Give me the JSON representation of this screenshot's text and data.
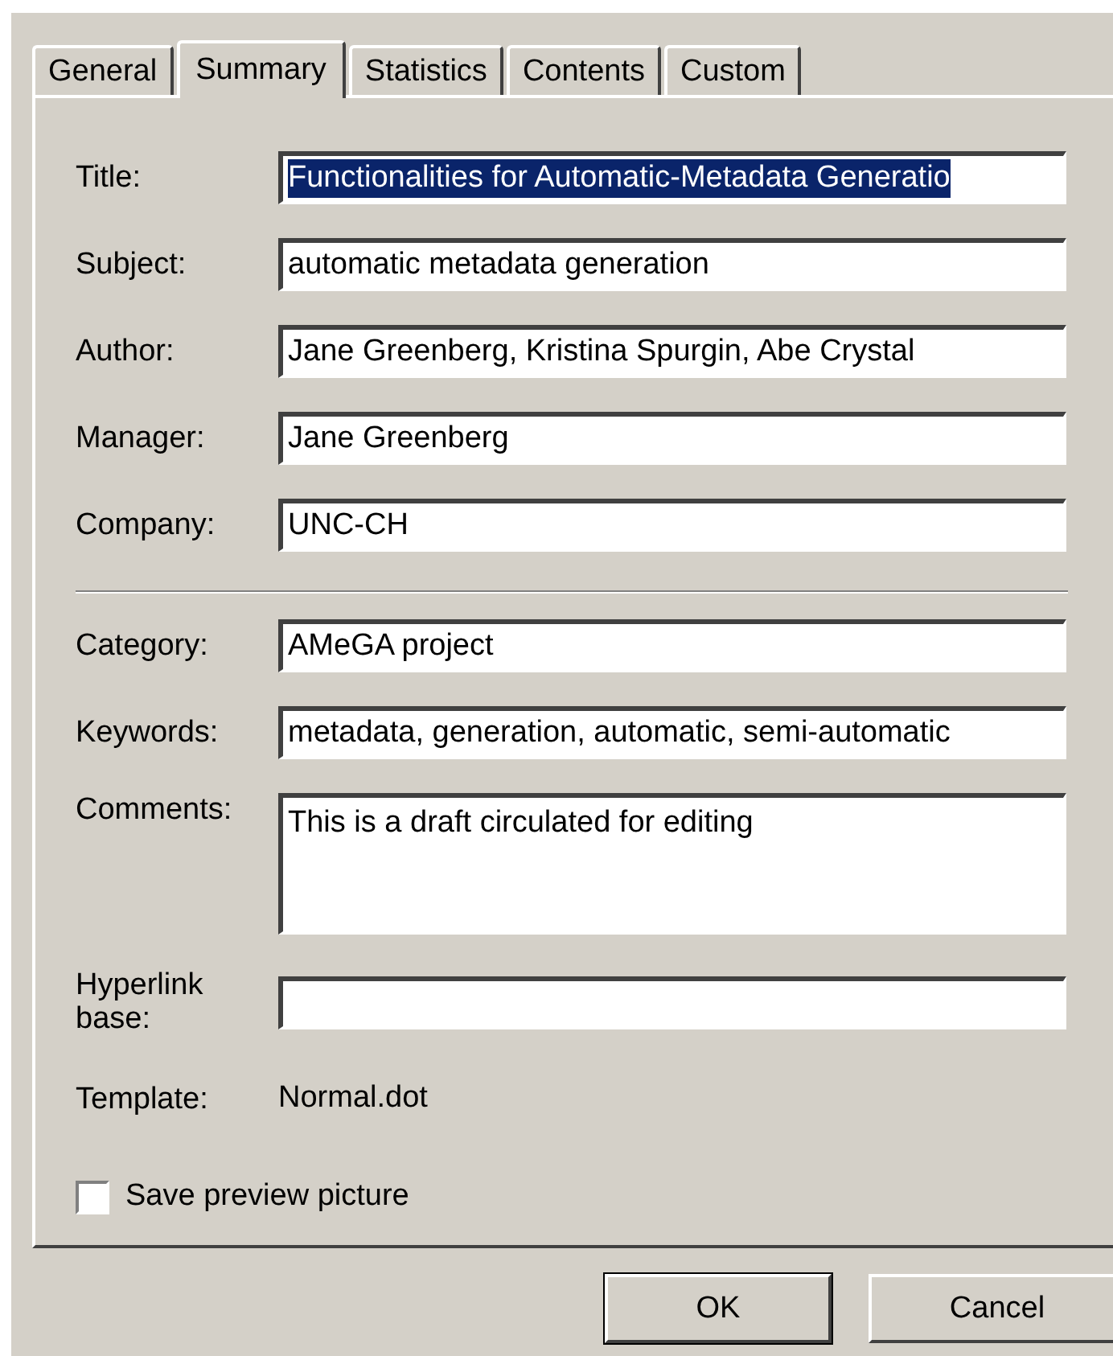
{
  "tabs": [
    {
      "label": "General",
      "selected": false
    },
    {
      "label": "Summary",
      "selected": true
    },
    {
      "label": "Statistics",
      "selected": false
    },
    {
      "label": "Contents",
      "selected": false
    },
    {
      "label": "Custom",
      "selected": false
    }
  ],
  "groups": [
    {
      "fields": [
        {
          "kind": "text",
          "label": "Title:",
          "value": "Functionalities for Automatic-Metadata Generatio",
          "highlighted": true
        },
        {
          "kind": "text",
          "label": "Subject:",
          "value": "automatic metadata generation"
        },
        {
          "kind": "text",
          "label": "Author:",
          "value": "Jane Greenberg, Kristina Spurgin, Abe Crystal"
        },
        {
          "kind": "text",
          "label": "Manager:",
          "value": "Jane Greenberg"
        },
        {
          "kind": "text",
          "label": "Company:",
          "value": "UNC-CH"
        }
      ]
    },
    {
      "fields": [
        {
          "kind": "text",
          "label": "Category:",
          "value": "AMeGA project"
        },
        {
          "kind": "text",
          "label": "Keywords:",
          "value": "metadata, generation, automatic, semi-automatic"
        },
        {
          "kind": "multiline",
          "label": "Comments:",
          "value": "This is a draft circulated for editing"
        },
        {
          "kind": "text",
          "label": "Hyperlink base:"
        },
        {
          "kind": "static",
          "label": "Template:",
          "value": "Normal.dot"
        }
      ]
    }
  ],
  "checkbox": {
    "label": "Save preview picture",
    "checked": false
  },
  "buttons": [
    "OK",
    "Cancel"
  ]
}
